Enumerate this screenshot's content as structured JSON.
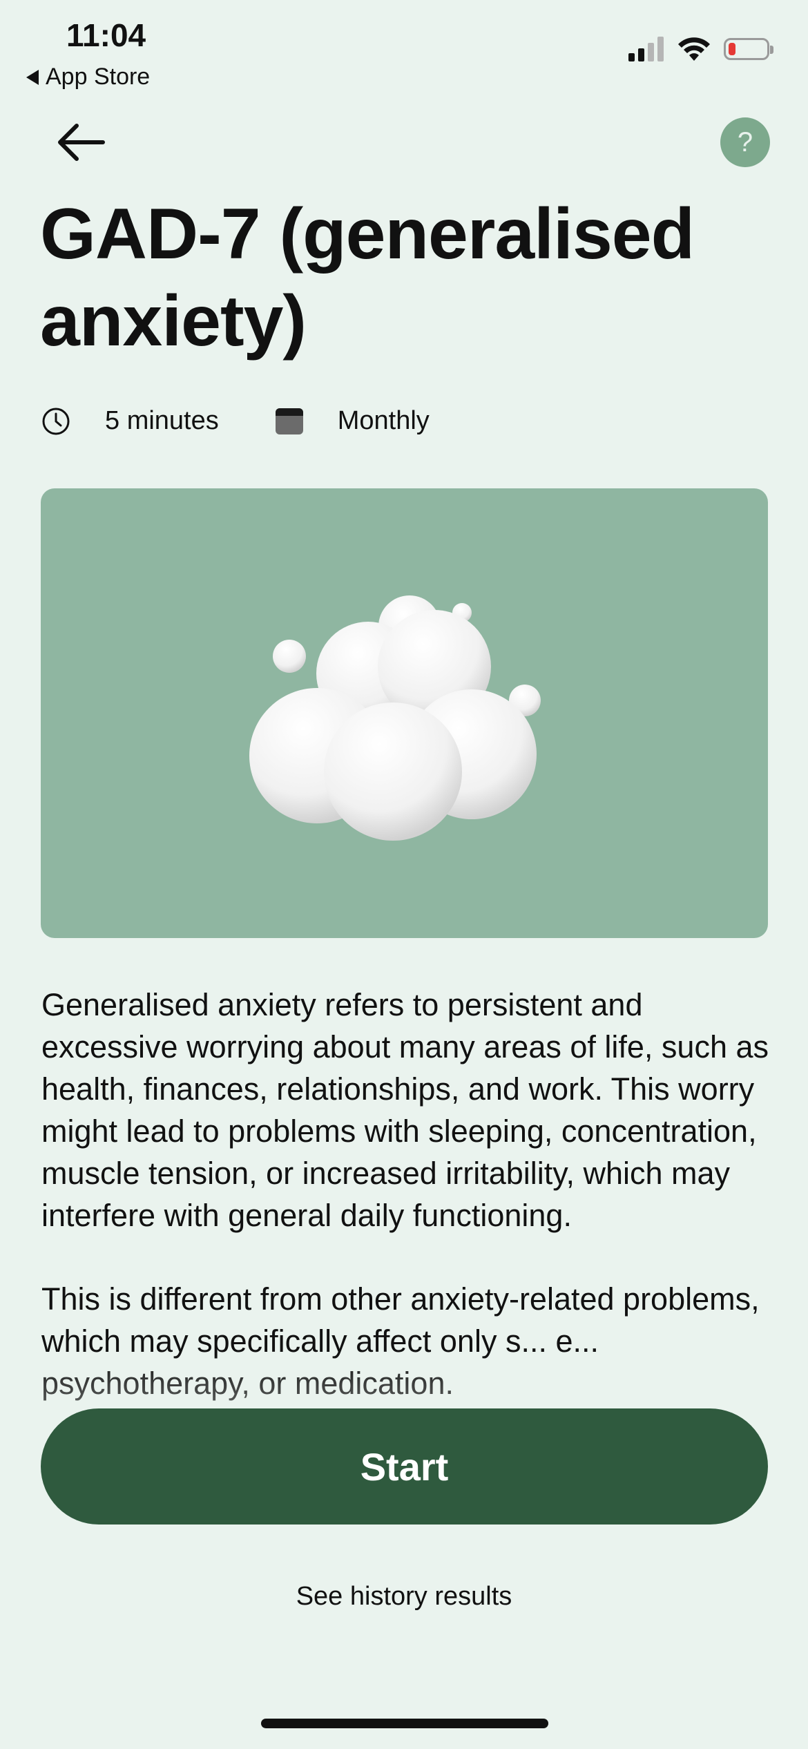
{
  "status_bar": {
    "time": "11:04",
    "back_app_label": "App Store",
    "battery_color": "#e53935"
  },
  "header": {
    "back_icon": "arrow-left-icon",
    "help_label": "?"
  },
  "title": "GAD-7 (generalised anxiety)",
  "meta": {
    "duration": "5 minutes",
    "duration_icon": "clock-icon",
    "frequency": "Monthly",
    "frequency_icon": "calendar-icon"
  },
  "hero": {
    "image": "cloud-illustration",
    "background": "#8fb6a1"
  },
  "description": {
    "paragraph_1": "Generalised anxiety refers to persistent and excessive worrying about many areas of life, such as health, finances, relationships, and work. This worry might lead to problems with sleeping, concentration, muscle tension, or increased irritability,  which may interfere with general daily functioning.",
    "paragraph_2": "This is different from other anxiety-related problems, which may specifically affect only s... e... psychotherapy, or medication."
  },
  "actions": {
    "start_label": "Start",
    "history_label": "See history results"
  },
  "colors": {
    "background": "#eaf3ee",
    "primary": "#2f5a3e",
    "accent": "#7da98d"
  }
}
